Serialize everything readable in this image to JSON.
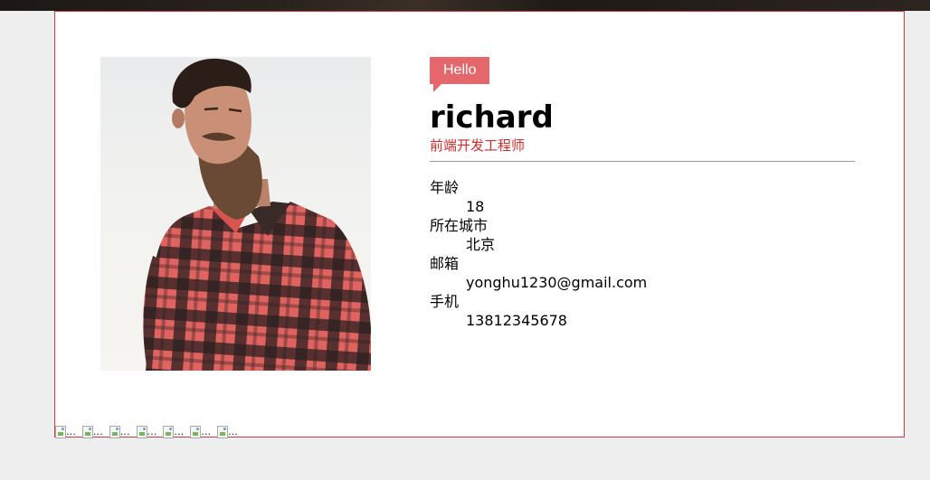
{
  "profile": {
    "greeting": "Hello",
    "name": "richard",
    "role": "前端开发工程师"
  },
  "details": [
    {
      "label": "年龄",
      "value": "18"
    },
    {
      "label": "所在城市",
      "value": "北京"
    },
    {
      "label": "邮箱",
      "value": "yonghu1230@gmail.com"
    },
    {
      "label": "手机",
      "value": "13812345678"
    }
  ],
  "broken_images": [
    "...",
    "...",
    "...",
    "...",
    "...",
    "...",
    "..."
  ],
  "colors": {
    "accent": "#e6676b",
    "role_text": "#d42a2a",
    "card_border": "#d33a3a",
    "page_bg": "#eeeeee"
  }
}
